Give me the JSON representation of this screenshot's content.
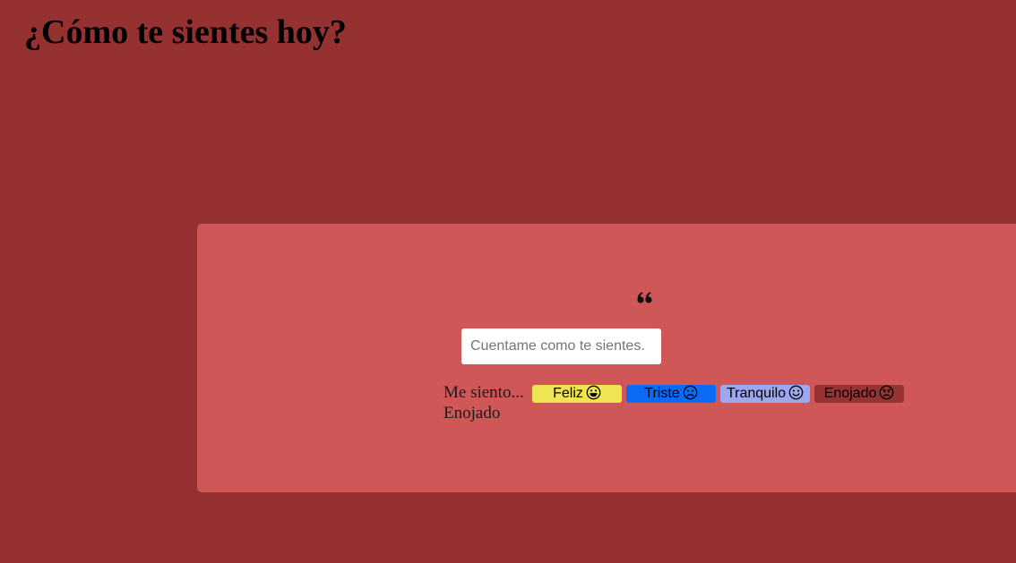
{
  "page": {
    "title": "¿Cómo te sientes hoy?",
    "background_color": "#963132"
  },
  "card": {
    "background_color": "#cf5757",
    "quote_icon": "quote-left-icon",
    "input": {
      "placeholder": "Cuentame como te sientes.",
      "value": ""
    },
    "prompt_label": "Me siento...",
    "moods": [
      {
        "label": "Feliz",
        "icon": "grinning-face-icon",
        "color": "#efe453"
      },
      {
        "label": "Triste",
        "icon": "sad-face-icon",
        "color": "#0a6cf5"
      },
      {
        "label": "Tranquilo",
        "icon": "smiling-face-icon",
        "color": "#9ca7ee"
      },
      {
        "label": "Enojado",
        "icon": "angry-face-icon",
        "color": "#983333"
      }
    ],
    "selected_mood": "Enojado"
  }
}
